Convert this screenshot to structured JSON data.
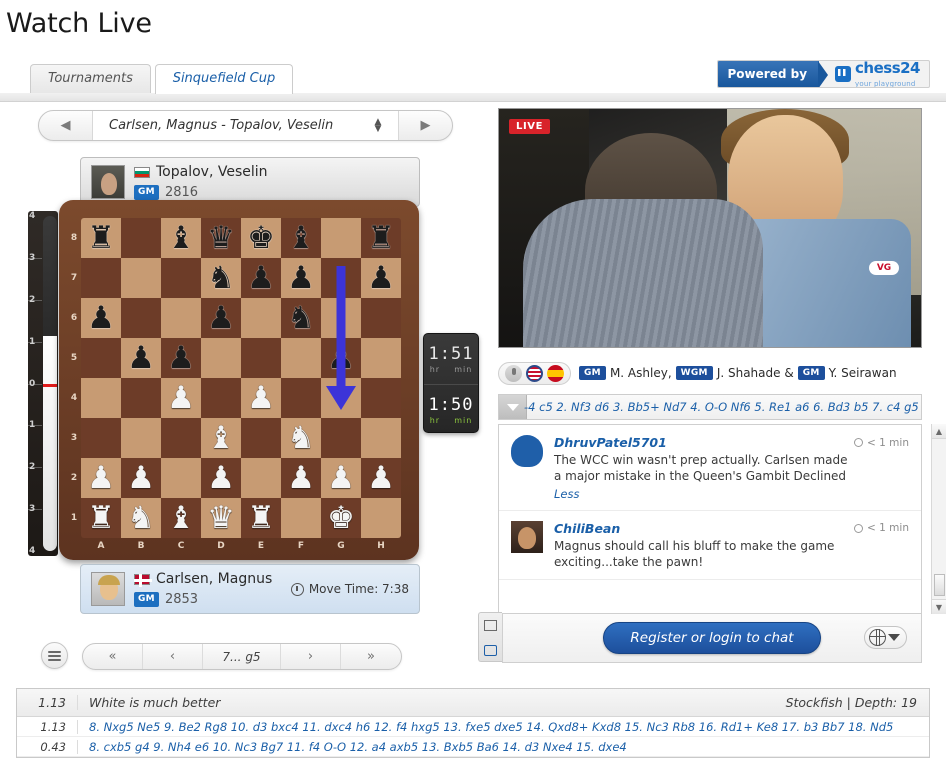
{
  "page": {
    "title": "Watch Live"
  },
  "tabs": [
    {
      "label": "Tournaments",
      "active": false
    },
    {
      "label": "Sinquefield Cup",
      "active": true
    }
  ],
  "powered_by": {
    "label": "Powered by",
    "brand": "chess24",
    "tagline": "your playground",
    "brand_color": "#1a6fc4"
  },
  "game_selector": {
    "title": "Carlsen, Magnus - Topalov, Veselin",
    "prev_icon": "triangle-left-icon",
    "next_icon": "triangle-right-icon",
    "spinner_icon": "up-down-arrows-icon"
  },
  "players": {
    "top": {
      "name": "Topalov, Veselin",
      "title": "GM",
      "rating": "2816",
      "flag": "bulgaria-flag-icon",
      "avatar": "topalov-avatar"
    },
    "bottom": {
      "name": "Carlsen, Magnus",
      "title": "GM",
      "rating": "2853",
      "flag": "norway-flag-icon",
      "avatar": "carlsen-avatar",
      "move_time_label": "Move Time: 7:38"
    }
  },
  "clocks": {
    "top": {
      "time": "1:51",
      "unit_hr": "hr",
      "unit_min": "min",
      "active": false
    },
    "bottom": {
      "time": "1:50",
      "unit_hr": "hr",
      "unit_min": "min",
      "active": true
    }
  },
  "eval_bar": {
    "scale": [
      "4",
      "3",
      "2",
      "1",
      "0",
      "1",
      "2",
      "3",
      "4"
    ],
    "value": 1.13,
    "zero_marker_color": "#e01b1b",
    "white_color": "#ffffff",
    "black_color": "#2b2b2b"
  },
  "board": {
    "ranks": [
      "8",
      "7",
      "6",
      "5",
      "4",
      "3",
      "2",
      "1"
    ],
    "files": [
      "A",
      "B",
      "C",
      "D",
      "E",
      "F",
      "G",
      "H"
    ],
    "light_square_color": "#c79b73",
    "dark_square_color": "#6d3c28",
    "arrow": {
      "from": "g7",
      "to": "g5",
      "color": "#3c34d8"
    },
    "rows": [
      [
        "r",
        "",
        "b",
        "q",
        "k",
        "b",
        "",
        "r"
      ],
      [
        "",
        "",
        "",
        "n",
        "p",
        "p",
        "",
        "p"
      ],
      [
        "p",
        "",
        "",
        "p",
        "",
        "n",
        "",
        ""
      ],
      [
        "",
        "p",
        "p",
        "",
        "",
        "",
        "p",
        ""
      ],
      [
        "",
        "",
        "P",
        "",
        "P",
        "",
        "",
        ""
      ],
      [
        "",
        "",
        "",
        "B",
        "",
        "N",
        "",
        ""
      ],
      [
        "P",
        "P",
        "",
        "P",
        "",
        "P",
        "P",
        "P"
      ],
      [
        "R",
        "N",
        "B",
        "Q",
        "R",
        "",
        "K",
        ""
      ]
    ]
  },
  "board_nav": {
    "menu_icon": "hamburger-menu-icon",
    "first_label": "«",
    "prev_label": "‹",
    "current_move": "7... g5",
    "next_label": "›",
    "last_label": "»"
  },
  "video": {
    "live_badge": "LIVE",
    "sponsor_logo": "VG"
  },
  "commentators": {
    "mic_icon": "microphone-icon",
    "lang_icons": [
      "usa-flag-icon",
      "spain-flag-icon"
    ],
    "entries": [
      {
        "title": "GM",
        "name": "M. Ashley,"
      },
      {
        "title": "WGM",
        "name": "J. Shahade &"
      },
      {
        "title": "GM",
        "name": "Y. Seirawan"
      }
    ]
  },
  "moves_strip": {
    "toggle_icon": "chevron-down-icon",
    "text": "-4 c5 2. Nf3 d6 3. Bb5+ Nd7 4. O-O Nf6 5. Re1 a6 6. Bd3 b5 7. c4 g5"
  },
  "chat": {
    "messages": [
      {
        "user": "DhruvPatel5701",
        "time": "< 1 min",
        "text": "The WCC win wasn't prep actually. Carlsen made a major mistake in the Queen's Gambit Declined",
        "more_label": "Less",
        "avatar": "default-silhouette-avatar"
      },
      {
        "user": "ChiliBean",
        "time": "< 1 min",
        "text": "Magnus should call his bluff to make the game exciting...take the pawn!",
        "avatar": "user-photo-avatar"
      }
    ],
    "footer": {
      "login_label": "Register or login to chat",
      "globe_icon": "globe-icon",
      "caret_icon": "caret-down-icon",
      "side_tabs": [
        "list-view-icon",
        "chat-bubble-icon"
      ]
    },
    "scrollbar": {
      "up_icon": "scroll-up-arrow-icon",
      "down_icon": "scroll-down-arrow-icon"
    }
  },
  "engine": {
    "header": {
      "score": "1.13",
      "verdict": "White is much better",
      "engine_info": "Stockfish | Depth: 19"
    },
    "lines": [
      {
        "score": "1.13",
        "moves": "8. Nxg5 Ne5 9. Be2 Rg8 10. d3 bxc4 11. dxc4 h6 12. f4 hxg5 13. fxe5 dxe5 14. Qxd8+ Kxd8 15. Nc3 Rb8 16. Rd1+ Ke8 17. b3 Bb7 18. Nd5"
      },
      {
        "score": "0.43",
        "moves": "8. cxb5 g4 9. Nh4 e6 10. Nc3 Bg7 11. f4 O-O 12. a4 axb5 13. Bxb5 Ba6 14. d3 Nxe4 15. dxe4"
      }
    ]
  }
}
